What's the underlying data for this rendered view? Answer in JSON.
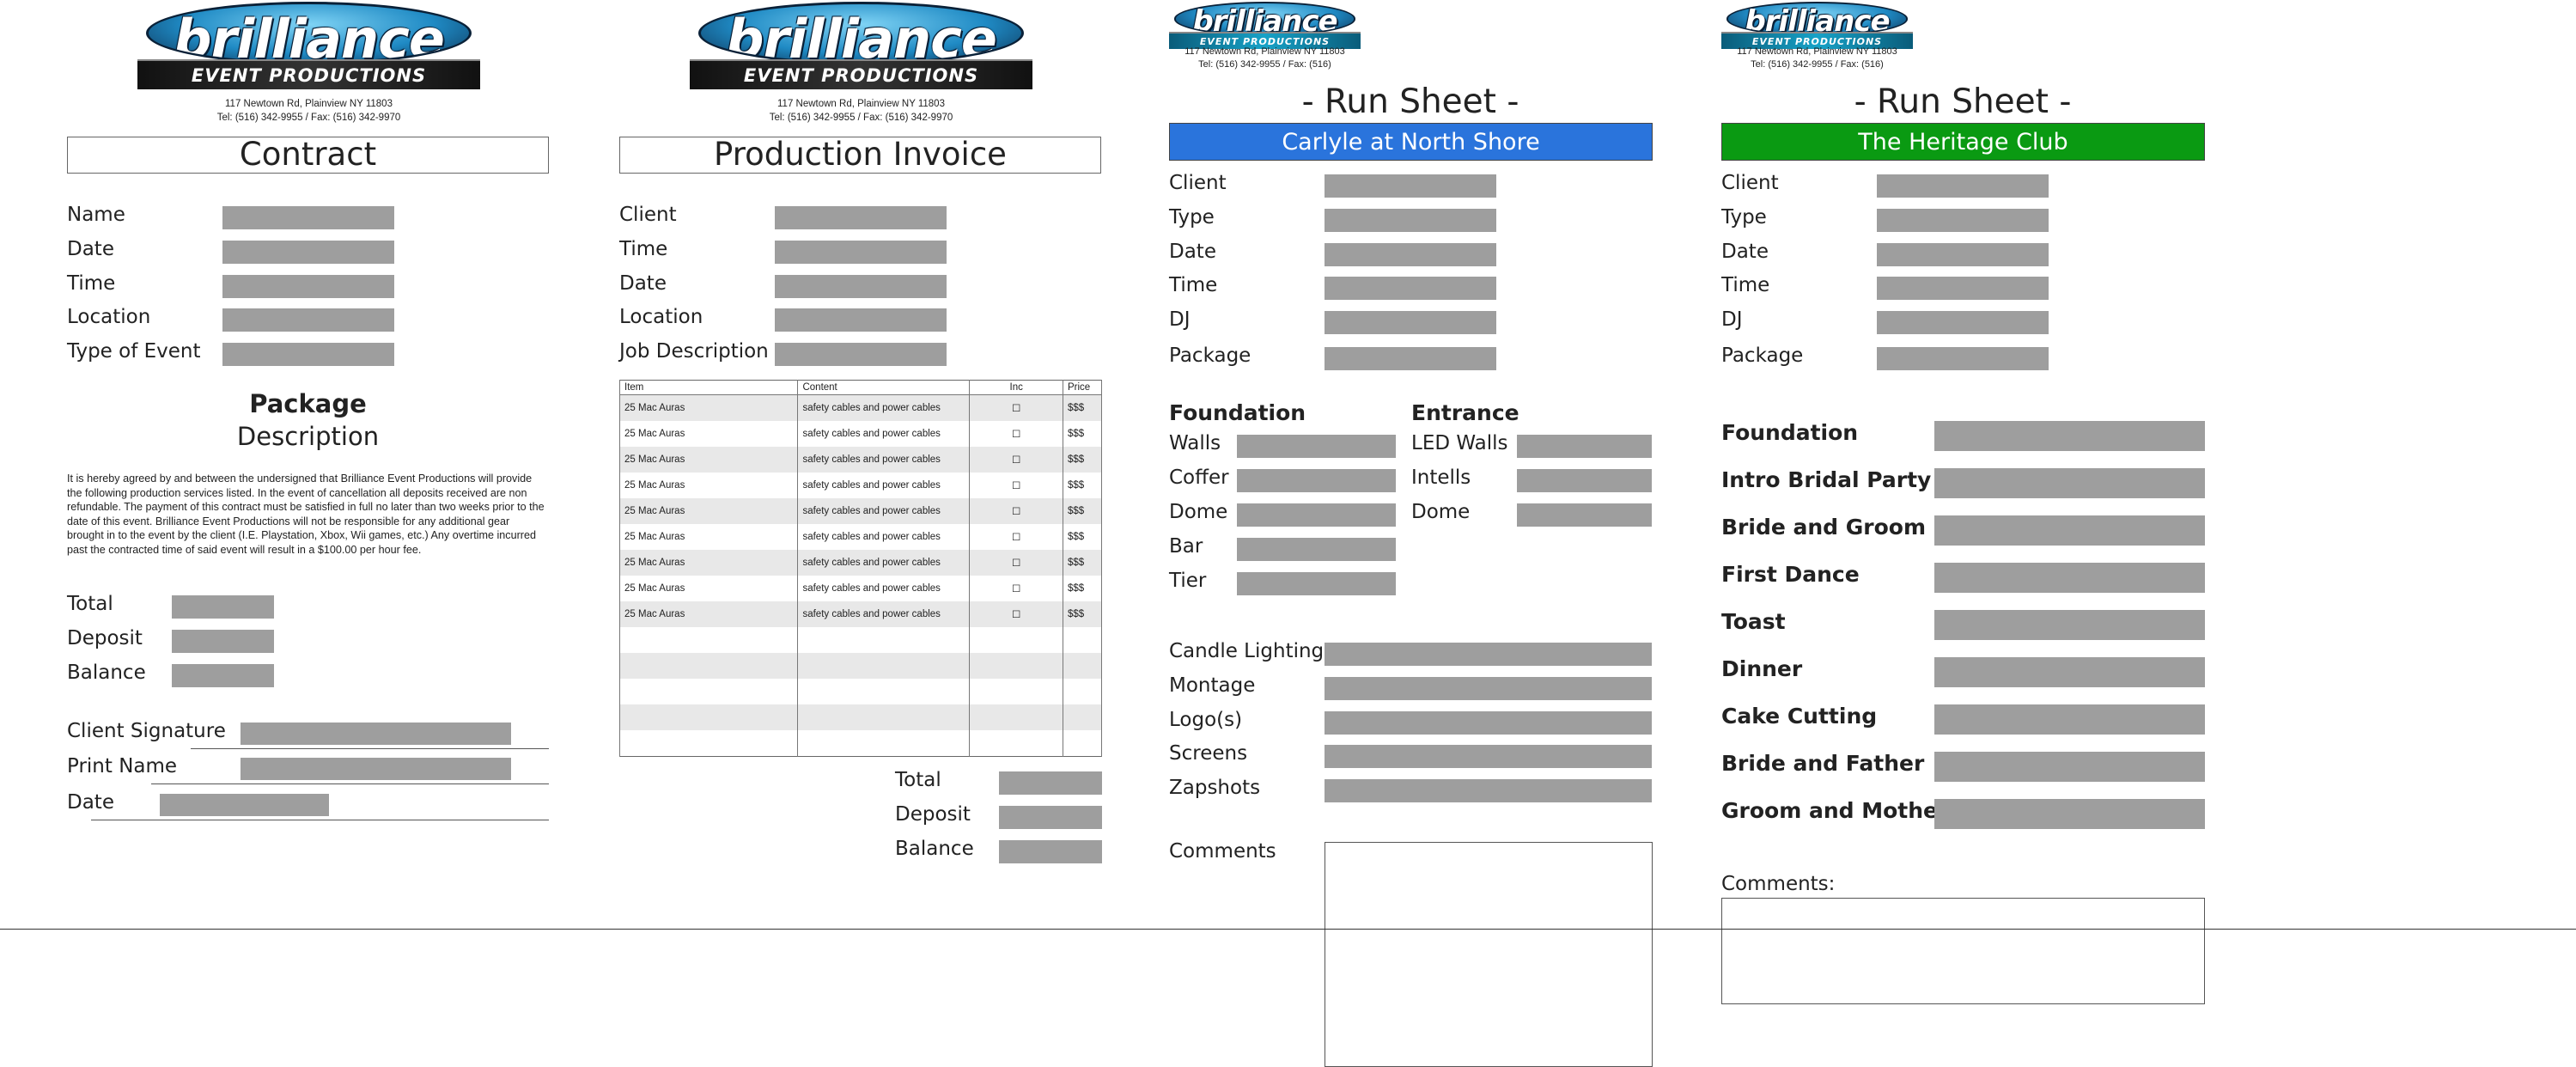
{
  "logo": {
    "word": "brilliance",
    "tagline": "EVENT PRODUCTIONS"
  },
  "address": {
    "line1": "117 Newtown Rd, Plainview NY 11803",
    "line2_full": "Tel: (516) 342-9955 / Fax: (516) 342-9970",
    "line2_short": "Tel: (516) 342-9955 / Fax: (516)"
  },
  "contract": {
    "title": "Contract",
    "fields": [
      "Name",
      "Date",
      "Time",
      "Location",
      "Type of Event"
    ],
    "package_heading": "Package",
    "package_sub": "Description",
    "terms": "It is hereby agreed by and between the undersigned that Brilliance Event Productions will provide the following production services listed. In the event of cancellation all deposits received are non refundable. The payment of this contract must be satisfied in full no later than two weeks prior to the date of this event. Brilliance Event Productions will not be responsible for any additional gear brought in to the event by the client (I.E. Playstation, Xbox, Wii games, etc.) Any overtime incurred past the contracted time of said event will result in a $100.00 per hour fee.",
    "totals": [
      "Total",
      "Deposit",
      "Balance"
    ],
    "signature": [
      "Client Signature",
      "Print Name",
      "Date"
    ]
  },
  "invoice": {
    "title": "Production Invoice",
    "fields": [
      "Client",
      "Time",
      "Date",
      "Location",
      "Job Description"
    ],
    "table": {
      "headers": [
        "Item",
        "Content",
        "Inc",
        "Price"
      ],
      "rows": [
        [
          "25 Mac Auras",
          "safety cables and power cables",
          "☐",
          "$$$"
        ],
        [
          "25 Mac Auras",
          "safety cables and power cables",
          "☐",
          "$$$"
        ],
        [
          "25 Mac Auras",
          "safety cables and power cables",
          "☐",
          "$$$"
        ],
        [
          "25 Mac Auras",
          "safety cables and power cables",
          "☐",
          "$$$"
        ],
        [
          "25 Mac Auras",
          "safety cables and power cables",
          "☐",
          "$$$"
        ],
        [
          "25 Mac Auras",
          "safety cables and power cables",
          "☐",
          "$$$"
        ],
        [
          "25 Mac Auras",
          "safety cables and power cables",
          "☐",
          "$$$"
        ],
        [
          "25 Mac Auras",
          "safety cables and power cables",
          "☐",
          "$$$"
        ],
        [
          "25 Mac Auras",
          "safety cables and power cables",
          "☐",
          "$$$"
        ],
        [
          "",
          "",
          "",
          ""
        ],
        [
          "",
          "",
          "",
          ""
        ],
        [
          "",
          "",
          "",
          ""
        ],
        [
          "",
          "",
          "",
          ""
        ],
        [
          "",
          "",
          "",
          ""
        ]
      ]
    },
    "totals": [
      "Total",
      "Deposit",
      "Balance"
    ]
  },
  "runsheet1": {
    "title": "- Run Sheet -",
    "venue": "Carlyle at North Shore",
    "venue_color": "#2a74dc",
    "fields": [
      "Client",
      "Type",
      "Date",
      "Time",
      "DJ",
      "Package"
    ],
    "foundation_heading": "Foundation",
    "foundation": [
      "Walls",
      "Coffer",
      "Dome",
      "Bar",
      "Tier"
    ],
    "entrance_heading": "Entrance",
    "entrance": [
      "LED Walls",
      "Intells",
      "Dome"
    ],
    "extras": [
      "Candle Lighting",
      "Montage",
      "Logo(s)",
      "Screens",
      "Zapshots"
    ],
    "comments": "Comments"
  },
  "runsheet2": {
    "title": "- Run Sheet -",
    "venue": "The Heritage Club",
    "venue_color": "#0a9a12",
    "fields": [
      "Client",
      "Type",
      "Date",
      "Time",
      "DJ",
      "Package"
    ],
    "events": [
      "Foundation",
      "Intro Bridal Party",
      "Bride and Groom",
      "First Dance",
      "Toast",
      "Dinner",
      "Cake Cutting",
      "Bride and Father",
      "Groom and Mother"
    ],
    "comments": "Comments:"
  }
}
